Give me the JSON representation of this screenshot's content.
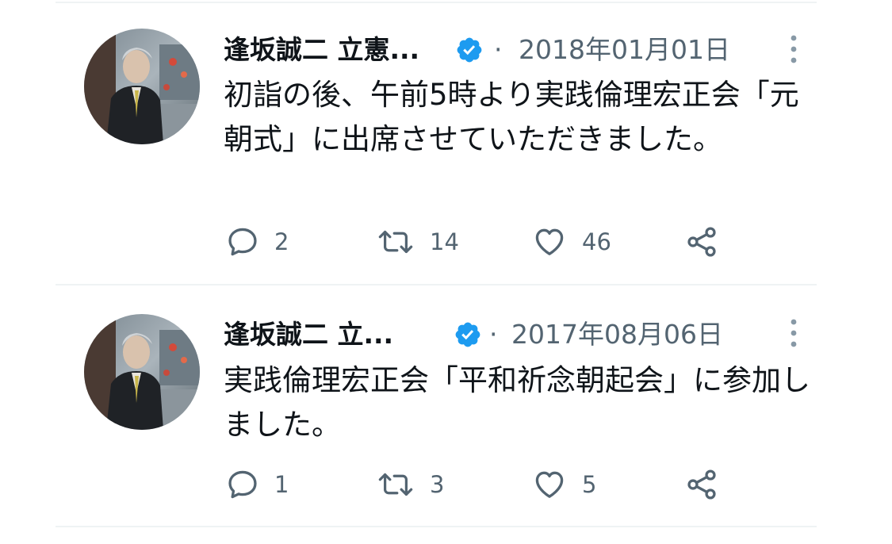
{
  "tweets": [
    {
      "author_name": "逢坂誠二 立憲...",
      "separator": "·",
      "date": "2018年01月01日",
      "text": "初詣の後、午前5時より実践倫理宏正会「元朝式」に出席させていただきました。",
      "replies": "2",
      "retweets": "14",
      "likes": "46"
    },
    {
      "author_name": "逢坂誠二 立...",
      "separator": "·",
      "date": "2017年08月06日",
      "text": "実践倫理宏正会「平和祈念朝起会」に参加しました。",
      "replies": "1",
      "retweets": "3",
      "likes": "5"
    }
  ],
  "colors": {
    "verified_blue": "#1d9bf0",
    "secondary_text": "#536471",
    "primary_text": "#0f1419",
    "divider": "#eff3f4"
  },
  "icons": {
    "reply": "reply-icon",
    "retweet": "retweet-icon",
    "like": "like-icon",
    "share": "share-icon",
    "verified": "verified-badge-icon",
    "more": "more-options-icon"
  }
}
